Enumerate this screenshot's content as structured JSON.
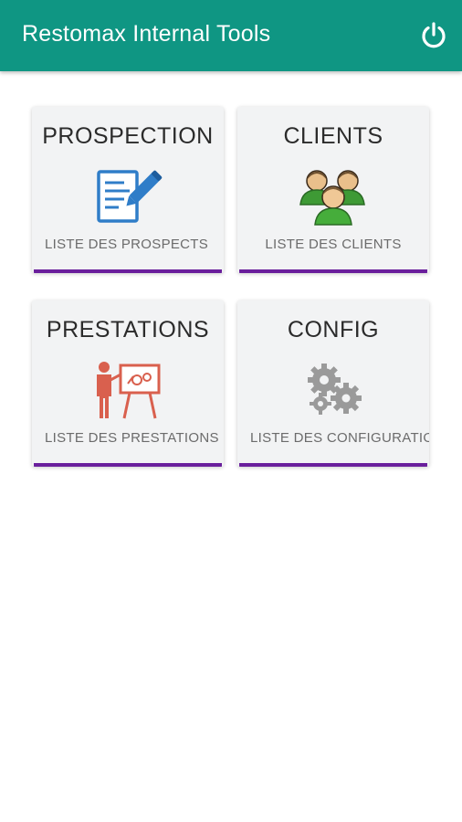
{
  "app": {
    "title": "Restomax Internal Tools",
    "power_icon": "power-icon",
    "brand_color": "#0f9683",
    "accent_color": "#6a1f9c"
  },
  "tiles": [
    {
      "title": "PROSPECTION",
      "subtitle": "LISTE DES PROSPECTS",
      "icon": "document-edit-icon"
    },
    {
      "title": "CLIENTS",
      "subtitle": "LISTE DES CLIENTS",
      "icon": "users-group-icon"
    },
    {
      "title": "PRESTATIONS",
      "subtitle": "LISTE DES PRESTATIONS",
      "icon": "presentation-icon"
    },
    {
      "title": "CONFIG",
      "subtitle": "LISTE DES CONFIGURATIONS",
      "icon": "gears-icon"
    }
  ]
}
